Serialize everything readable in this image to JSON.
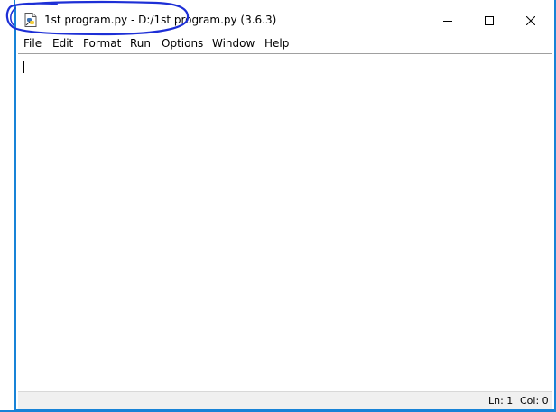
{
  "window": {
    "title": "1st program.py - D:/1st program.py (3.6.3)"
  },
  "menu": {
    "items": [
      "File",
      "Edit",
      "Format",
      "Run",
      "Options",
      "Window",
      "Help"
    ]
  },
  "editor": {
    "content": ""
  },
  "status": {
    "line": "Ln: 1",
    "column": "Col: 0"
  },
  "colors": {
    "accent_border": "#1883d7",
    "annotation": "#1d2fd6",
    "statusbar_bg": "#f0f0f0"
  },
  "icons": [
    "python-file-icon",
    "minimize-icon",
    "maximize-icon",
    "close-icon"
  ]
}
